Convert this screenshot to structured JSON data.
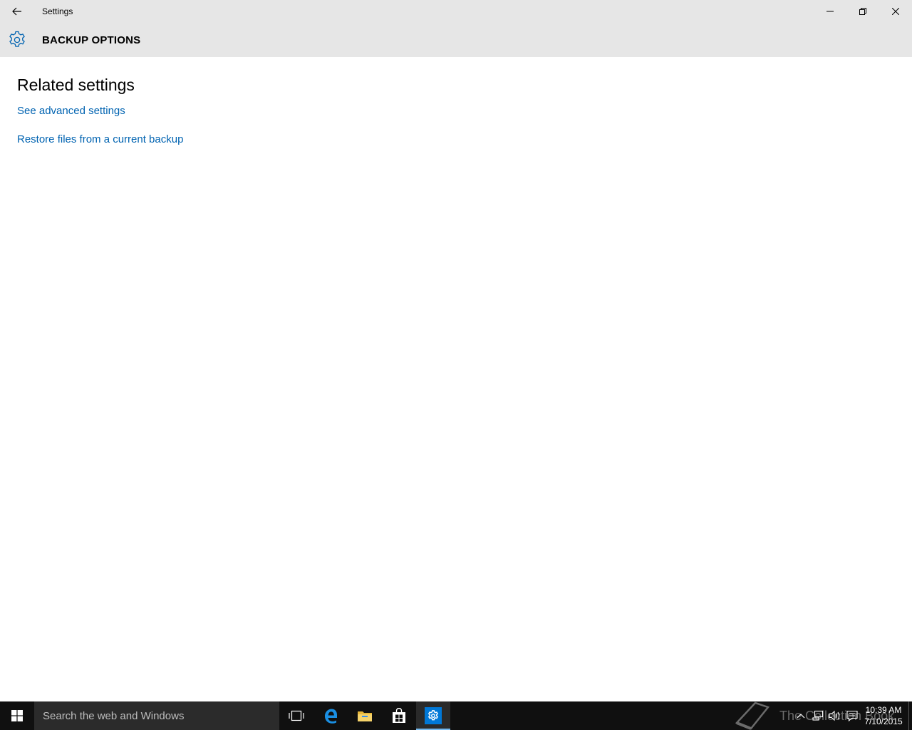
{
  "window": {
    "title": "Settings",
    "back_icon": "arrow-left-icon",
    "controls": {
      "minimize_icon": "minimize-icon",
      "restore_icon": "restore-icon",
      "close_icon": "close-icon"
    }
  },
  "header": {
    "icon": "gear-icon",
    "title": "BACKUP OPTIONS",
    "accent_color": "#0063b1"
  },
  "content": {
    "section_title": "Related settings",
    "links": [
      {
        "label": "See advanced settings"
      },
      {
        "label": "Restore files from a current backup"
      }
    ]
  },
  "taskbar": {
    "search_placeholder": "Search the web and Windows",
    "pinned": [
      {
        "name": "task-view-icon"
      },
      {
        "name": "edge-icon"
      },
      {
        "name": "file-explorer-icon"
      },
      {
        "name": "store-icon"
      },
      {
        "name": "settings-icon",
        "active": true
      }
    ],
    "watermark_text": "The Collection Book",
    "tray": {
      "icons": [
        "chevron-up-icon",
        "network-icon",
        "volume-icon",
        "action-center-icon"
      ],
      "time": "10:39 AM",
      "date": "7/10/2015"
    }
  }
}
